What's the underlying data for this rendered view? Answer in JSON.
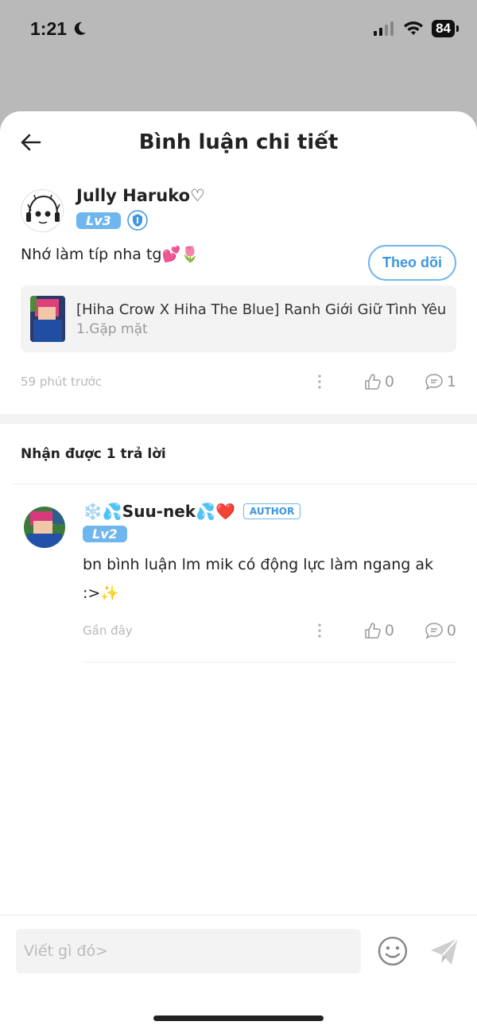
{
  "status": {
    "time": "1:21",
    "battery": "84"
  },
  "header": {
    "title": "Bình luận chi tiết"
  },
  "comment": {
    "username": "Jully Haruko♡",
    "level": "Lv3",
    "follow_label": "Theo dõi",
    "text": "Nhớ làm típ nha tg💕🌷",
    "story": {
      "title": "[Hiha Crow X Hiha The Blue] Ranh Giới Giữ Tình Yêu",
      "chapter": "1.Gặp mặt"
    },
    "time": "59 phút trước",
    "likes": "0",
    "replies": "1"
  },
  "replies_header": "Nhận được 1 trả lời",
  "reply": {
    "username": "❄️💦Suu-nek💦❤️",
    "author_badge": "AUTHOR",
    "level": "Lv2",
    "text": "bn bình luận lm mik có động lực làm ngang ak :>✨",
    "time": "Gần đây",
    "likes": "0",
    "replies": "0"
  },
  "input": {
    "placeholder": "Viết gì đó>"
  },
  "colors": {
    "accent": "#3d96de",
    "badge": "#6fb6ee"
  }
}
